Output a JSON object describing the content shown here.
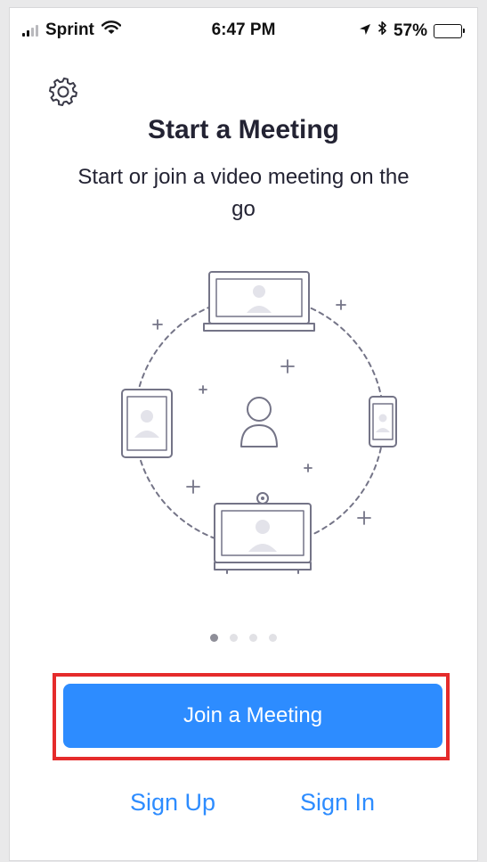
{
  "status_bar": {
    "carrier": "Sprint",
    "time": "6:47 PM",
    "battery": "57%",
    "battery_level": 0.57,
    "signal_bars_filled": 2,
    "signal_bars_total": 4
  },
  "header": {
    "settings_icon": "gear-icon"
  },
  "main": {
    "title": "Start a Meeting",
    "subtitle": "Start or join a video meeting on the go",
    "pagination": {
      "total": 4,
      "active": 0
    }
  },
  "actions": {
    "join_label": "Join a Meeting",
    "sign_up_label": "Sign Up",
    "sign_in_label": "Sign In"
  },
  "colors": {
    "accent": "#2d8cff",
    "highlight": "#e52b2b",
    "text": "#232333",
    "illustration": "#747487"
  }
}
